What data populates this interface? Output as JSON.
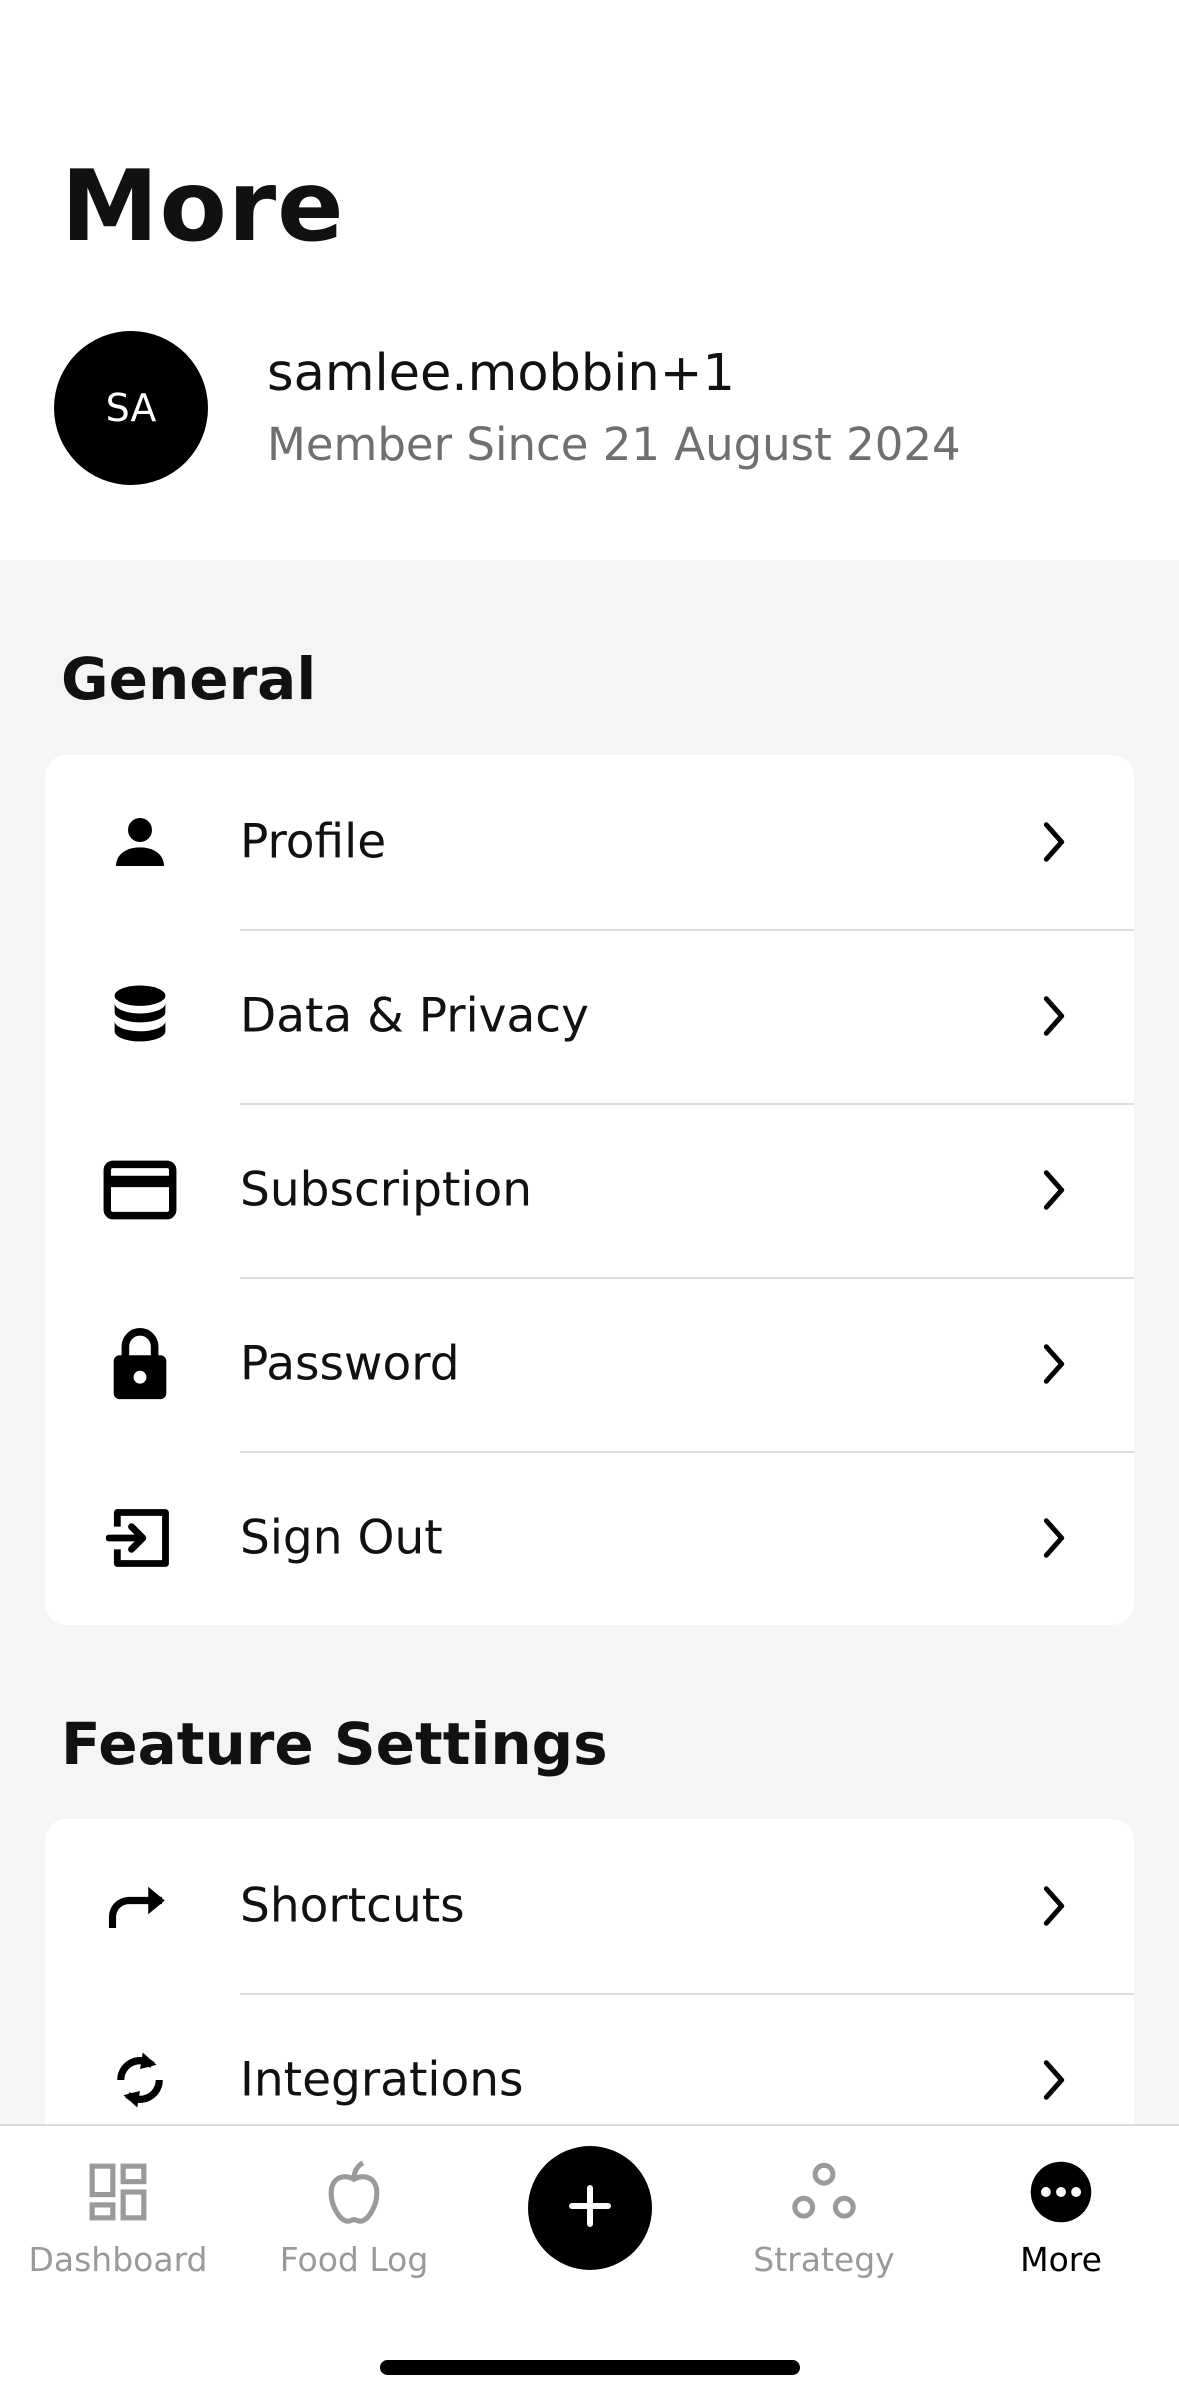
{
  "header": {
    "title": "More",
    "user": {
      "initials": "SA",
      "name": "samlee.mobbin+1",
      "member_since": "Member Since 21 August 2024"
    }
  },
  "sections": {
    "general": {
      "title": "General",
      "items": [
        {
          "label": "Profile",
          "icon": "person-icon"
        },
        {
          "label": "Data & Privacy",
          "icon": "database-icon"
        },
        {
          "label": "Subscription",
          "icon": "credit-card-icon"
        },
        {
          "label": "Password",
          "icon": "lock-icon"
        },
        {
          "label": "Sign Out",
          "icon": "sign-out-icon"
        }
      ]
    },
    "feature_settings": {
      "title": "Feature Settings",
      "items": [
        {
          "label": "Shortcuts",
          "icon": "forward-arrow-icon"
        },
        {
          "label": "Integrations",
          "icon": "sync-icon"
        }
      ]
    }
  },
  "tabbar": {
    "tabs": [
      {
        "label": "Dashboard",
        "icon": "dashboard-icon",
        "active": false
      },
      {
        "label": "Food Log",
        "icon": "apple-icon",
        "active": false
      },
      {
        "label": "Strategy",
        "icon": "strategy-icon",
        "active": false
      },
      {
        "label": "More",
        "icon": "more-dots-icon",
        "active": true
      }
    ],
    "add_icon": "plus-icon"
  },
  "colors": {
    "background": "#f5f5f5",
    "card": "#ffffff",
    "primary": "#000000",
    "secondary_text": "#6f6f6f",
    "inactive_tab": "#9a9a9a"
  }
}
